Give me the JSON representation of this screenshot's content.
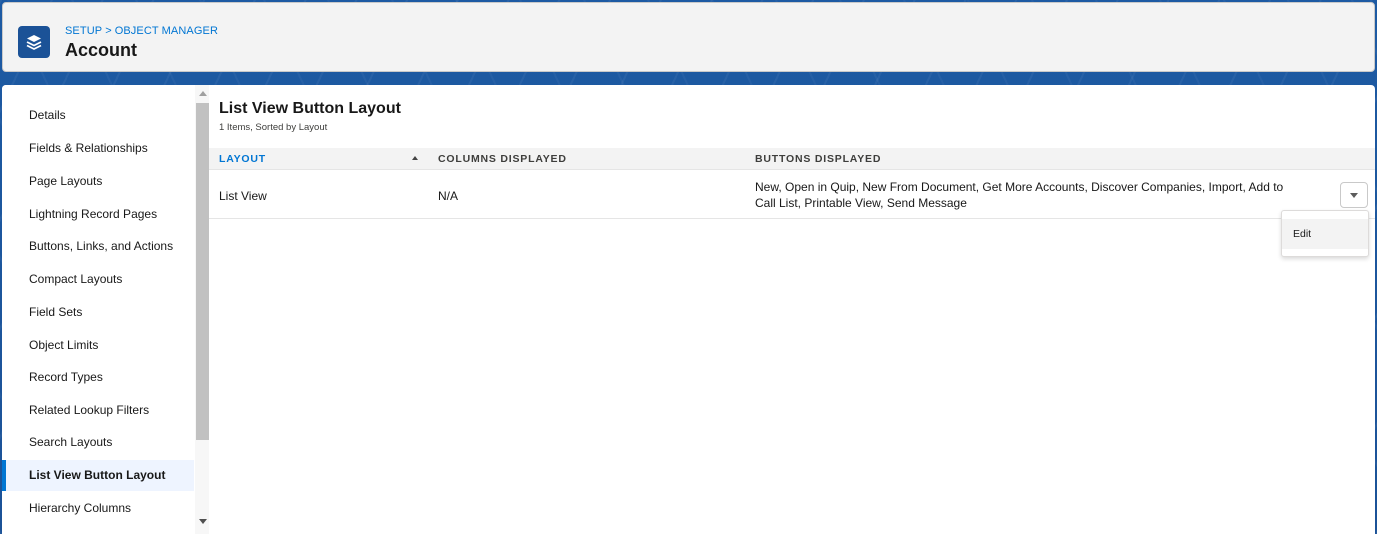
{
  "header": {
    "breadcrumb": [
      "SETUP",
      "OBJECT MANAGER"
    ],
    "breadcrumb_separator": ">",
    "title": "Account",
    "icon": "layers-icon"
  },
  "sidebar": {
    "items": [
      {
        "label": "Details",
        "active": false
      },
      {
        "label": "Fields & Relationships",
        "active": false
      },
      {
        "label": "Page Layouts",
        "active": false
      },
      {
        "label": "Lightning Record Pages",
        "active": false
      },
      {
        "label": "Buttons, Links, and Actions",
        "active": false
      },
      {
        "label": "Compact Layouts",
        "active": false
      },
      {
        "label": "Field Sets",
        "active": false
      },
      {
        "label": "Object Limits",
        "active": false
      },
      {
        "label": "Record Types",
        "active": false
      },
      {
        "label": "Related Lookup Filters",
        "active": false
      },
      {
        "label": "Search Layouts",
        "active": false
      },
      {
        "label": "List View Button Layout",
        "active": true
      },
      {
        "label": "Hierarchy Columns",
        "active": false
      }
    ]
  },
  "main": {
    "title": "List View Button Layout",
    "subtitle": "1 Items, Sorted by Layout",
    "columns": [
      "LAYOUT",
      "COLUMNS DISPLAYED",
      "BUTTONS DISPLAYED"
    ],
    "sorted_column": "LAYOUT",
    "rows": [
      {
        "layout": "List View",
        "columns_displayed": "N/A",
        "buttons_displayed_line1": "New, Open in Quip, New From Document, Get More Accounts, Discover Companies, Import, Add to",
        "buttons_displayed_line2": "Call List, Printable View, Send Message"
      }
    ],
    "row_menu": {
      "items": [
        "Edit"
      ]
    }
  },
  "colors": {
    "accent": "#0176d3",
    "banner": "#1b5297",
    "active_nav_bg": "#eef4ff"
  }
}
